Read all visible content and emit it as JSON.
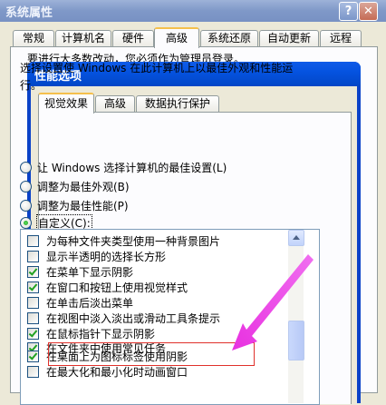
{
  "outer_window": {
    "title": "系统属性",
    "help_glyph": "?",
    "close_glyph": "✕",
    "tabs": [
      "常规",
      "计算机名",
      "硬件",
      "高级",
      "系统还原",
      "自动更新",
      "远程"
    ],
    "active_tab": "高级",
    "partial_text": "要进行大多数改动，您必须作为管理员登录。"
  },
  "dialog": {
    "title": "性能选项",
    "tabs": [
      "视觉效果",
      "高级",
      "数据执行保护"
    ],
    "active_tab": "视觉效果",
    "description": "选择设置使 Windows 在此计算机上以最佳外观和性能运行。",
    "radio_options": [
      {
        "label": "让 Windows 选择计算机的最佳设置(L)",
        "selected": false
      },
      {
        "label": "调整为最佳外观(B)",
        "selected": false
      },
      {
        "label": "调整为最佳性能(P)",
        "selected": false
      },
      {
        "label": "自定义(C):",
        "selected": true
      }
    ],
    "effects": [
      {
        "label": "为每种文件夹类型使用一种背景图片",
        "checked": false
      },
      {
        "label": "显示半透明的选择长方形",
        "checked": false
      },
      {
        "label": "在菜单下显示阴影",
        "checked": true
      },
      {
        "label": "在窗口和按钮上使用视觉样式",
        "checked": true
      },
      {
        "label": "在单击后淡出菜单",
        "checked": false
      },
      {
        "label": "在视图中淡入淡出或滑动工具条提示",
        "checked": false
      },
      {
        "label": "在鼠标指针下显示阴影",
        "checked": true
      },
      {
        "label": "在文件夹中使用常见任务",
        "checked": true
      },
      {
        "label": "在桌面上为图标标签使用阴影",
        "checked": true
      },
      {
        "label": "在最大化和最小化时动画窗口",
        "checked": false
      }
    ],
    "highlighted_item": "在桌面上为图标标签使用阴影"
  },
  "colors": {
    "annotation_arrow": "#e831e0",
    "highlight_box": "#e0312b",
    "dialog_titlebar": "#0553e0"
  }
}
